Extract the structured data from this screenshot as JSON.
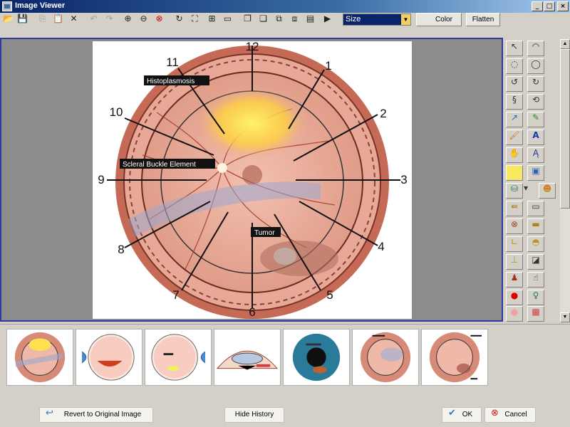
{
  "window": {
    "title": "Image Viewer"
  },
  "toolbar": {
    "size_value": "Size",
    "color_label": "Color",
    "flatten_label": "Flatten"
  },
  "diagram": {
    "clock_numbers": [
      "12",
      "1",
      "2",
      "3",
      "4",
      "5",
      "6",
      "7",
      "8",
      "9",
      "10",
      "11"
    ],
    "labels": {
      "histoplasmosis": "Histoplasmosis",
      "scleral_buckle": "Scleral Buckle Element",
      "tumor": "Tumor"
    }
  },
  "history": {
    "thumbnails": [
      "fundus-drawing-1",
      "eye-cross-section-1",
      "eye-cross-section-2",
      "anterior-segment",
      "iris-photo",
      "fundus-drawing-2",
      "fundus-drawing-3"
    ]
  },
  "buttons": {
    "revert": "Revert to Original Image",
    "hide_history": "Hide History",
    "ok": "OK",
    "cancel": "Cancel"
  },
  "colors": {
    "title_bar": "#0a246a",
    "canvas_border": "#2a3aa0",
    "retina": "#e8a898",
    "fundus_rim": "#b45a48",
    "yellow_lesion": "#ffe040"
  }
}
